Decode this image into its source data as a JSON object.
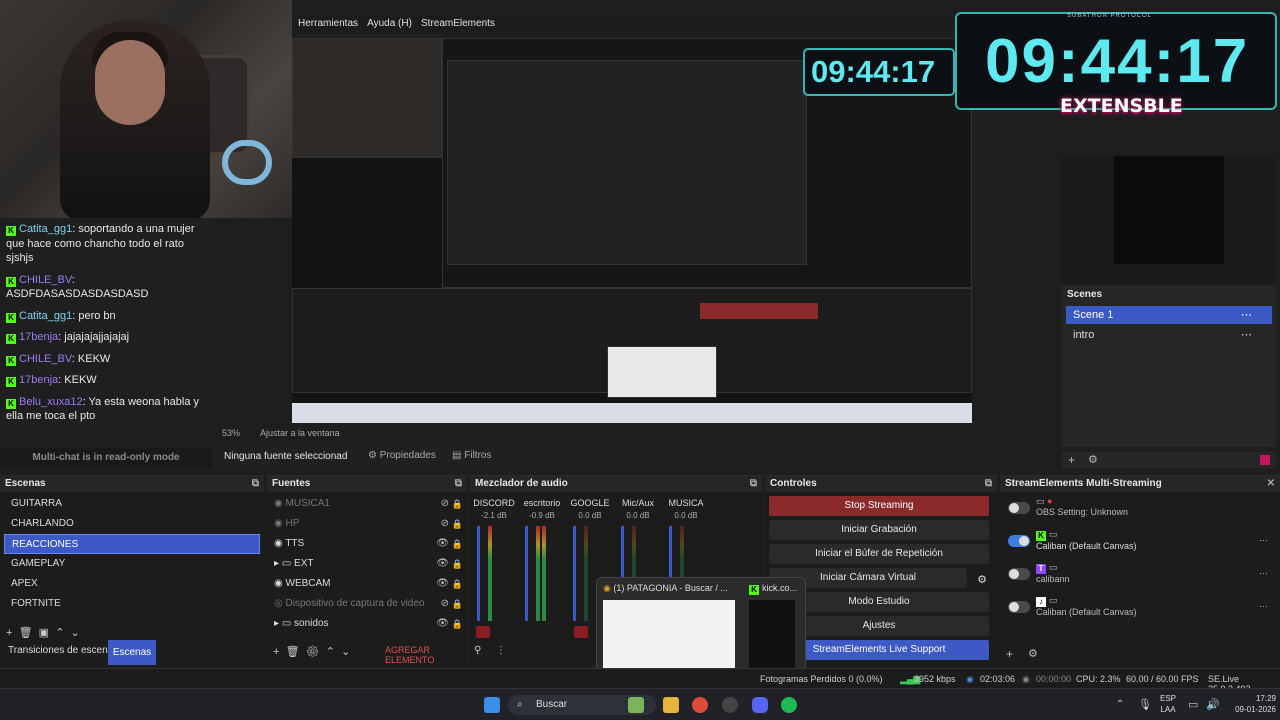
{
  "menu": {
    "items": [
      "Herramientas",
      "Ayuda (H)",
      "StreamElements"
    ]
  },
  "timer": {
    "value": "09:44:17",
    "mini": "09:44:17",
    "caption": "SUBATHON PROTOCOL",
    "logo_text": "EXTENSBLE"
  },
  "chat": {
    "messages": [
      {
        "user": "Catita_gg1",
        "text": "soportando a una mujer que hace como chancho todo el rato sjshjs"
      },
      {
        "user": "CHILE_BV",
        "text": "ASDFDASASDASDASDASD"
      },
      {
        "user": "Catita_gg1",
        "text": "pero bn"
      },
      {
        "user": "17benja",
        "text": "jajajajajjajajaj"
      },
      {
        "user": "CHILE_BV",
        "text": "KEKW"
      },
      {
        "user": "17benja",
        "text": "KEKW"
      },
      {
        "user": "Belu_xuxa12",
        "text": "Ya esta weona habla y ella me toca el pto"
      }
    ],
    "footer": "Multi-chat is in read-only mode"
  },
  "preview_bar": {
    "zoom": "53%",
    "fit": "Ajustar a la ventana"
  },
  "source_bar": {
    "no_source": "Ninguna fuente seleccionad",
    "properties": "Propiedades",
    "filters": "Filtros"
  },
  "scenes_right": {
    "title": "Scenes",
    "items": [
      "Scene 1",
      "intro"
    ]
  },
  "scenes": {
    "title": "Escenas",
    "items": [
      "GUITARRA",
      "CHARLANDO",
      "REACCIONES",
      "GAMEPLAY",
      "APEX",
      "FORTNITE"
    ],
    "selected": "REACCIONES",
    "tab_transitions": "Transiciones de escena",
    "tab_scenes": "Escenas"
  },
  "sources": {
    "title": "Fuentes",
    "items": [
      "MUSICA1",
      "HP",
      "TTS",
      "EXT",
      "WEBCAM",
      "Dispositivo de captura de video",
      "sonidos"
    ],
    "add_label": "AGREGAR ELEMENTO"
  },
  "mixer": {
    "title": "Mezclador de audio",
    "channels": [
      {
        "name": "DISCORD",
        "db": "-2.1 dB"
      },
      {
        "name": "escritorio",
        "db": "-0.9 dB"
      },
      {
        "name": "GOOGLE",
        "db": "0.0 dB"
      },
      {
        "name": "Mic/Aux",
        "db": "0.0 dB"
      },
      {
        "name": "MUSICA",
        "db": "0.0 dB"
      }
    ]
  },
  "controls": {
    "title": "Controles",
    "stop_streaming": "Stop Streaming",
    "start_recording": "Iniciar Grabación",
    "replay_buffer": "Iniciar el Búfer de Repetición",
    "virtual_camera": "Iniciar Cámara Virtual",
    "studio_mode": "Modo Estudio",
    "settings": "Ajustes",
    "se_support": "StreamElements Live Support"
  },
  "streamelements": {
    "title": "StreamElements Multi-Streaming",
    "rows": [
      {
        "label": "OBS Setting: Unknown",
        "on": false
      },
      {
        "label": "Caliban (Default Canvas)",
        "on": true
      },
      {
        "label": "calibann",
        "on": false
      },
      {
        "label": "Caliban (Default Canvas)",
        "on": false
      }
    ]
  },
  "status": {
    "dropped": "Fotogramas Perdidos 0 (0.0%)",
    "bitrate": "3952 kbps",
    "live_time": "02:03:06",
    "rec_time": "00:00:00",
    "cpu": "CPU: 2.3%",
    "fps": "60.00 / 60.00 FPS",
    "version": "SE.Live 25.9.3.493"
  },
  "taskbar": {
    "search": "Buscar",
    "lang": "ESP",
    "lang2": "LAA",
    "time": "17:29",
    "date": "09-01-2026"
  },
  "popup": {
    "tab1": "(1) PATAGONIA - Buscar / ...",
    "tab2": "kick.co..."
  }
}
